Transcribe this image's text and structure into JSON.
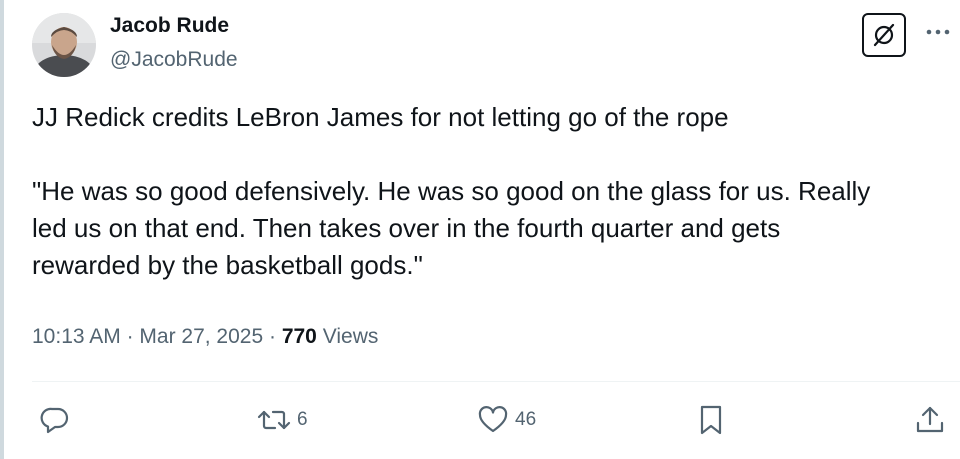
{
  "author": {
    "name": "Jacob Rude",
    "handle": "@JacobRude"
  },
  "tweet": {
    "line1": "JJ Redick credits LeBron James for not letting go of the rope",
    "quote_line1": "\"He was so good defensively. He was so good on the glass for us. Really",
    "quote_line2": "led us on that end. Then takes over in the fourth quarter and gets",
    "quote_line3": "rewarded by the basketball gods.\""
  },
  "meta": {
    "time": "10:13 AM",
    "separator": "·",
    "date": "Mar 27, 2025",
    "views_count": "770",
    "views_label": "Views"
  },
  "actions": {
    "reply_count": "",
    "retweet_count": "6",
    "like_count": "46"
  },
  "icons": {
    "grok": "grok-icon",
    "more": "more-icon",
    "reply": "reply-icon",
    "retweet": "retweet-icon",
    "like": "heart-icon",
    "bookmark": "bookmark-icon",
    "share": "share-icon"
  },
  "colors": {
    "text": "#0f1419",
    "secondary": "#536471",
    "border": "#cfd9de"
  }
}
